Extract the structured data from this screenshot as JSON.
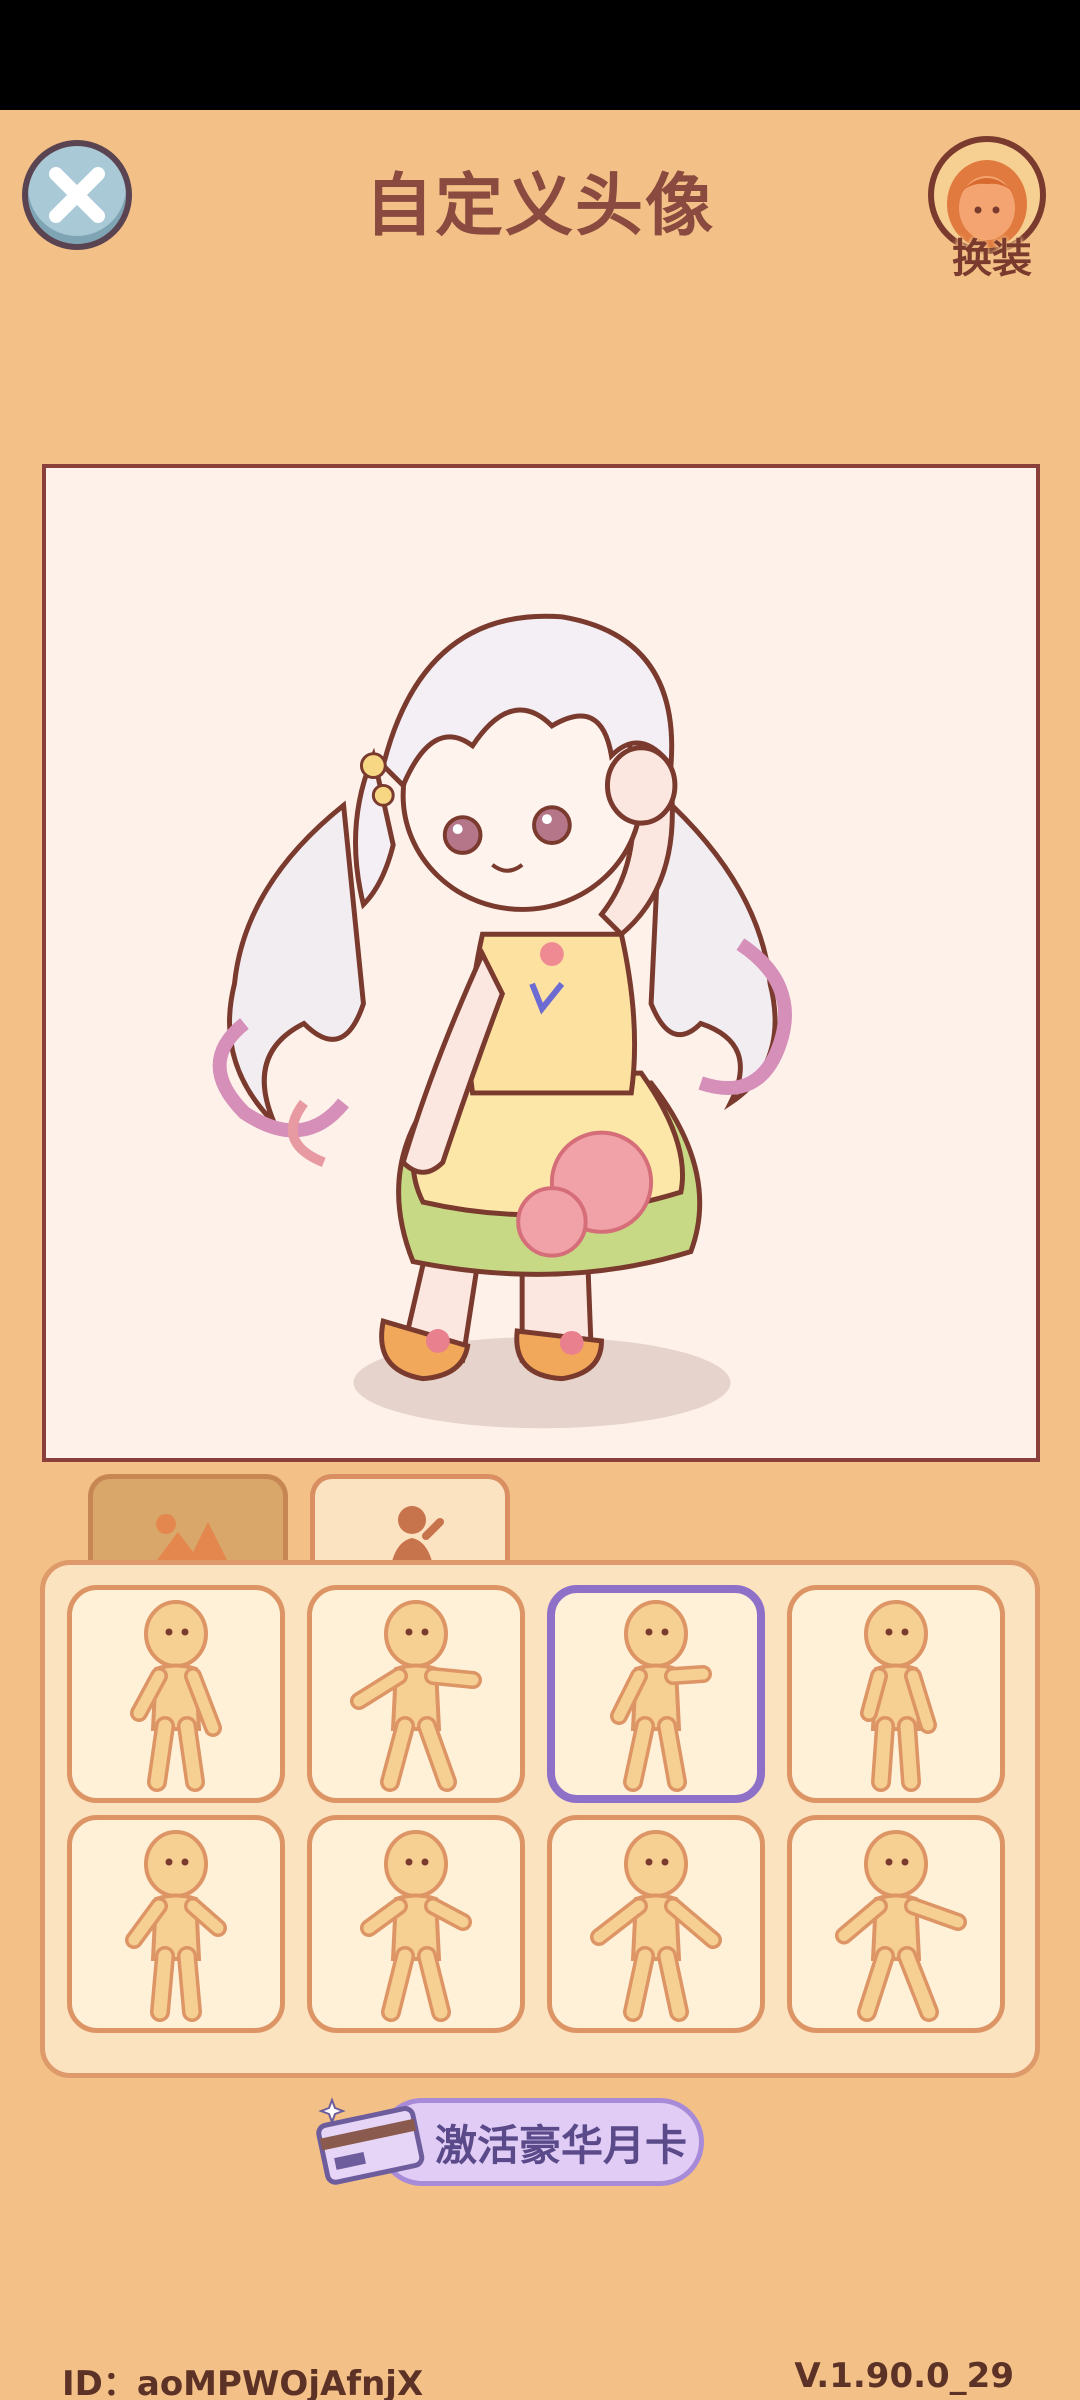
{
  "header": {
    "title": "自定义头像",
    "dress_label": "换装"
  },
  "tabs": [
    {
      "name": "background",
      "icon": "mountain-icon"
    },
    {
      "name": "pose",
      "icon": "person-icon"
    }
  ],
  "poses": {
    "count": 8,
    "selected_index": 2
  },
  "promo": {
    "label": "激活豪华月卡"
  },
  "footer": {
    "id_text": "ID：aoMPWOjAfnjX",
    "version": "V.1.90.0_29"
  },
  "colors": {
    "background": "#F3C187",
    "panel": "#FBE3BF",
    "selected": "#8F70C9",
    "title": "#8A4A3F"
  }
}
